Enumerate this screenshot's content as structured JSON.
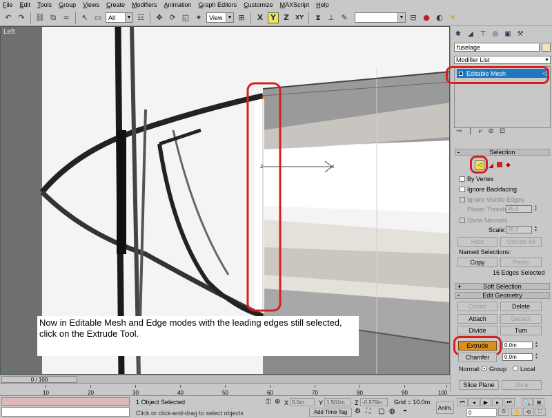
{
  "menu": [
    "File",
    "Edit",
    "Tools",
    "Group",
    "Views",
    "Create",
    "Modifiers",
    "Animation",
    "Graph Editors",
    "Customize",
    "MAXScript",
    "Help"
  ],
  "toolbar": {
    "filter_value": "All",
    "ref_coord_value": "View",
    "named_selection_value": ""
  },
  "viewport": {
    "label": "Left",
    "gizmo_z": "z",
    "gizmo_x": "x",
    "instruction": "Now in Editable Mesh and Edge modes with the leading edges still selected, click on the Extrude Tool."
  },
  "command_panel": {
    "object_name": "fuselage",
    "modifier_list_label": "Modifier List",
    "stack_item": "Editable Mesh",
    "selection": {
      "title": "Selection",
      "by_vertex": "By Vertex",
      "ignore_backfacing": "Ignore Backfacing",
      "ignore_visible_edges": "Ignore Visible Edges",
      "planar_thresh_label": "Planar Thresh:",
      "planar_thresh_value": "45.0",
      "show_normals": "Show Normals",
      "scale_label": "Scale:",
      "scale_value": "20.0",
      "hide_button": "Hide",
      "unhide_all_button": "Unhide All",
      "named_selections": "Named Selections:",
      "copy_button": "Copy",
      "paste_button": "Paste",
      "selected_count": "16 Edges Selected"
    },
    "soft_selection_title": "Soft Selection",
    "edit_geometry": {
      "title": "Edit Geometry",
      "create_button": "Create",
      "delete_button": "Delete",
      "attach_button": "Attach",
      "detach_button": "Detach",
      "divide_button": "Divide",
      "turn_button": "Turn",
      "extrude_button": "Extrude",
      "extrude_value": "0.0m",
      "chamfer_button": "Chamfer",
      "chamfer_value": "0.0m",
      "normal_label": "Normal:",
      "group_label": "Group",
      "local_label": "Local",
      "slice_plane_button": "Slice Plane",
      "slice_button": "Slice"
    }
  },
  "timeline": {
    "slider_label": "0 / 100",
    "ticks": [
      "10",
      "20",
      "30",
      "40",
      "50",
      "60",
      "70",
      "80",
      "90",
      "100"
    ]
  },
  "status": {
    "selected_text": "1 Object Selected",
    "prompt_text": "Click or click-and-drag to select objects",
    "x_label": "X",
    "x_value": "0.0m",
    "y_label": "Y",
    "y_value": "1.501m",
    "z_label": "Z",
    "z_value": "-0.579m",
    "grid_text": "Grid = 10.0m",
    "add_time_tag": "Add Time Tag",
    "anim_label": "Anim.",
    "frame_value": "0"
  }
}
